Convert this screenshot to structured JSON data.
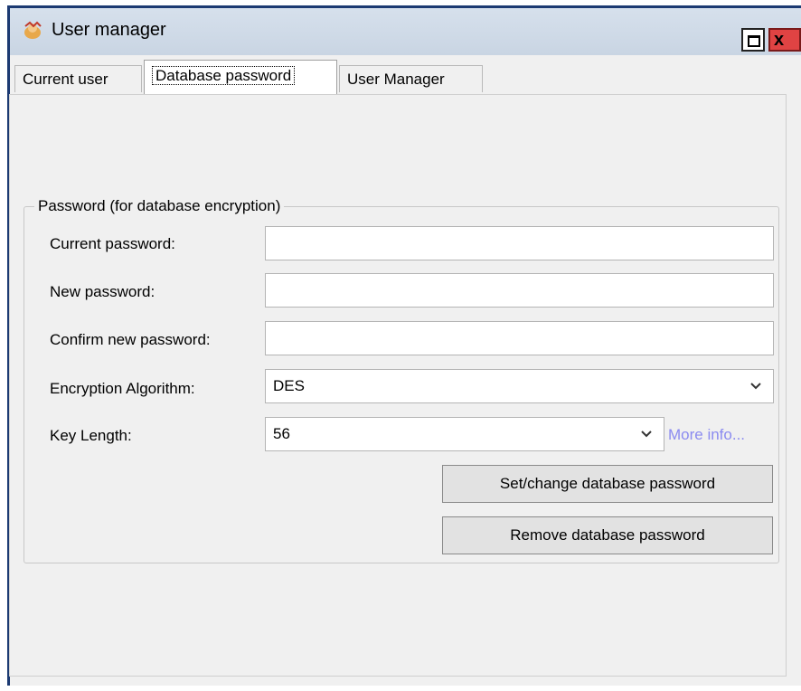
{
  "window": {
    "title": "User manager",
    "app_icon": "user-manager-icon"
  },
  "titlebar_buttons": {
    "maximize_icon": "maximize-icon",
    "close_icon": "close-icon",
    "close_glyph": "x"
  },
  "tabs": [
    {
      "label": "Current user",
      "active": false
    },
    {
      "label": "Database password",
      "active": true
    },
    {
      "label": "User Manager",
      "active": false
    }
  ],
  "group": {
    "legend": "Password (for database encryption)"
  },
  "form": {
    "current_password_label": "Current password:",
    "current_password_value": "",
    "new_password_label": "New password:",
    "new_password_value": "",
    "confirm_password_label": "Confirm new password:",
    "confirm_password_value": "",
    "algorithm_label": "Encryption Algorithm:",
    "algorithm_value": "DES",
    "key_length_label": "Key Length:",
    "key_length_value": "56",
    "more_info_link": "More info..."
  },
  "buttons": {
    "set_change": "Set/change database password",
    "remove": "Remove database password"
  }
}
